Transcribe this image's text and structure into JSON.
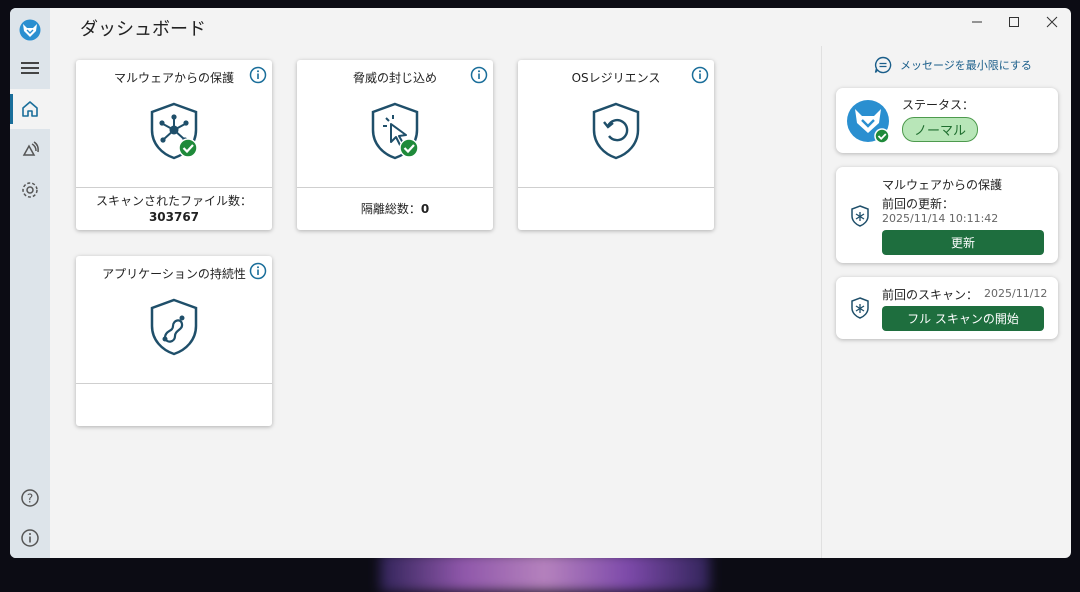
{
  "header": {
    "title": "ダッシュボード"
  },
  "cards": [
    {
      "title": "マルウェアからの保護",
      "footer_label": "スキャンされたファイル数：",
      "footer_value": "303767"
    },
    {
      "title": "脅威の封じ込め",
      "footer_text": "隔離総数：",
      "footer_value": "0"
    },
    {
      "title": "OSレジリエンス"
    },
    {
      "title": "アプリケーションの持続性"
    }
  ],
  "right_panel": {
    "minimize_link": "メッセージを最小限にする",
    "status": {
      "label": "ステータス：",
      "value": "ノーマル"
    },
    "malware": {
      "title": "マルウェアからの保護",
      "last_update_label": "前回の更新：",
      "last_update_value": "2025/11/14 10:11:42",
      "button": "更新"
    },
    "scan": {
      "last_scan_label": "前回のスキャン：",
      "last_scan_value": "2025/11/12",
      "button": "フル スキャンの開始"
    }
  },
  "colors": {
    "accent": "#1a6e9a",
    "green": "#1e6e3e",
    "icon": "#1f4f6a"
  }
}
